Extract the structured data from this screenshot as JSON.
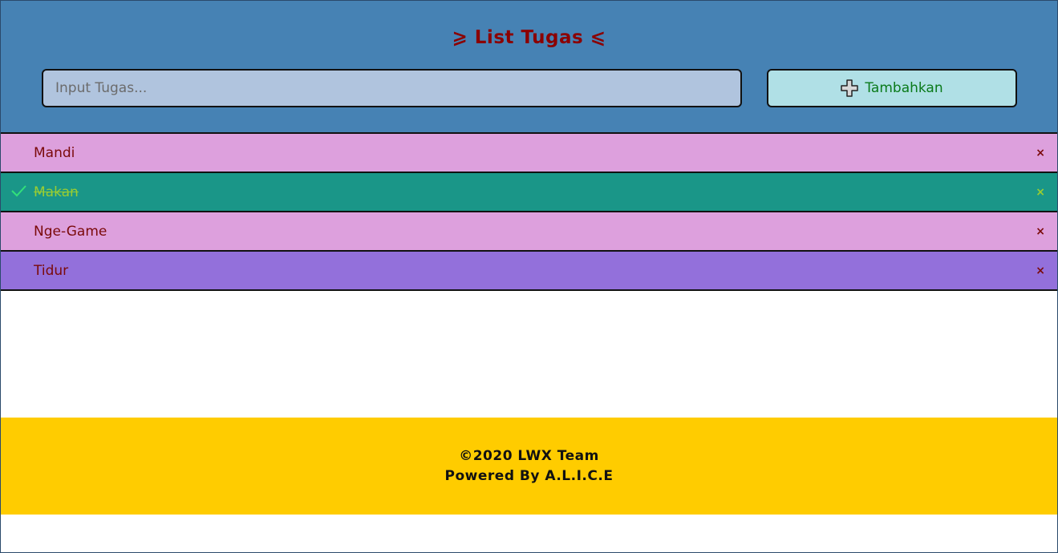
{
  "header": {
    "title": "⩾ List Tugas ⩽",
    "input_placeholder": "Input Tugas...",
    "input_value": "",
    "add_button_label": "Tambahkan"
  },
  "colors": {
    "header_bg": "#4682b4",
    "title": "#8b0000",
    "input_bg": "#b0c4de",
    "button_bg": "#b0e0e6",
    "button_text": "#0a7a1a",
    "footer_bg": "#ffcc00"
  },
  "tasks": [
    {
      "label": "Mandi",
      "done": false,
      "bg": "#dda0dd",
      "color": "#7a0a0a",
      "close": "×",
      "close_color": "#7a0a0a"
    },
    {
      "label": "Makan",
      "done": true,
      "bg": "#1a9688",
      "color": "#9acd32",
      "close": "×",
      "close_color": "#9acd32"
    },
    {
      "label": "Nge-Game",
      "done": false,
      "bg": "#dda0dd",
      "color": "#7a0a0a",
      "close": "×",
      "close_color": "#7a0a0a"
    },
    {
      "label": "Tidur",
      "done": false,
      "bg": "#9370db",
      "color": "#7a0a0a",
      "close": "×",
      "close_color": "#7a0a0a"
    }
  ],
  "footer": {
    "line1": "©2020 LWX Team",
    "line2": "Powered By A.L.I.C.E"
  }
}
